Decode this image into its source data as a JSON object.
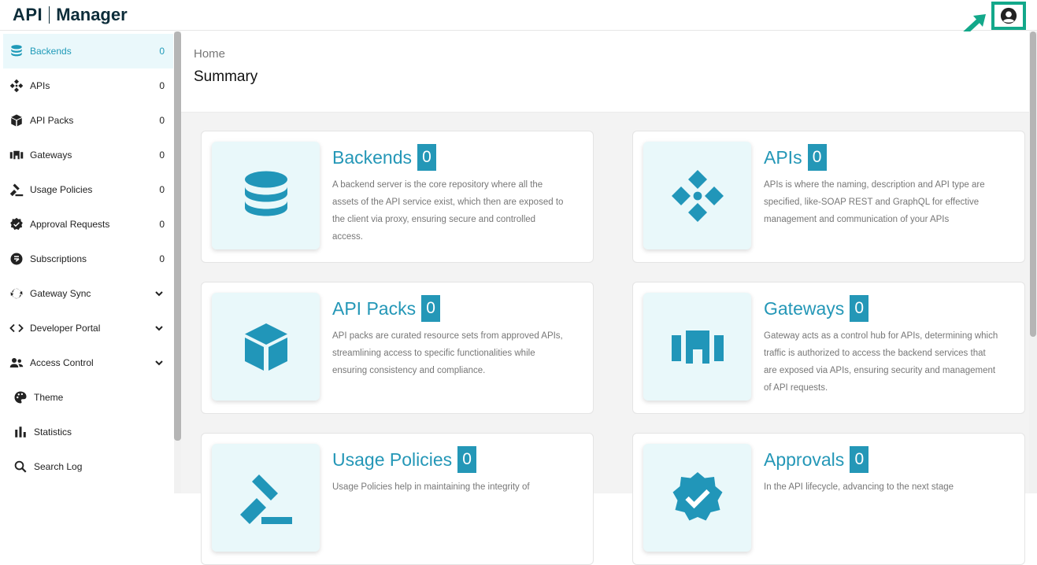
{
  "app": {
    "logo_api": "API",
    "logo_manager": "Manager"
  },
  "header": {
    "breadcrumb": "Home",
    "title": "Summary"
  },
  "sidebar": {
    "items": [
      {
        "label": "Backends",
        "count": "0",
        "icon": "database-icon"
      },
      {
        "label": "APIs",
        "count": "0",
        "icon": "api-diamond-icon"
      },
      {
        "label": "API Packs",
        "count": "0",
        "icon": "box-icon"
      },
      {
        "label": "Gateways",
        "count": "0",
        "icon": "gateway-icon"
      },
      {
        "label": "Usage Policies",
        "count": "0",
        "icon": "gavel-icon"
      },
      {
        "label": "Approval Requests",
        "count": "0",
        "icon": "check-badge-icon"
      },
      {
        "label": "Subscriptions",
        "count": "0",
        "icon": "subscription-icon"
      },
      {
        "label": "Gateway Sync",
        "icon": "sync-icon"
      },
      {
        "label": "Developer Portal",
        "icon": "code-icon"
      },
      {
        "label": "Access Control",
        "icon": "users-icon"
      },
      {
        "label": "Theme",
        "icon": "palette-icon"
      },
      {
        "label": "Statistics",
        "icon": "bar-chart-icon"
      },
      {
        "label": "Search Log",
        "icon": "search-icon"
      }
    ]
  },
  "cards": [
    {
      "title": "Backends",
      "count": "0",
      "icon": "database-icon",
      "desc": "A backend server is the core repository where all the assets of the API service exist, which then are exposed to the client via proxy, ensuring secure and controlled access."
    },
    {
      "title": "APIs",
      "count": "0",
      "icon": "api-diamond-icon",
      "desc": "APIs is where the naming, description and API type are specified, like-SOAP REST and GraphQL for effective management and communication of your APIs"
    },
    {
      "title": "API Packs",
      "count": "0",
      "icon": "box-icon",
      "desc": "API packs are curated resource sets from approved APIs, streamlining access to specific functionalities while ensuring consistency and compliance."
    },
    {
      "title": "Gateways",
      "count": "0",
      "icon": "gateway-icon",
      "desc": "Gateway acts as a control hub for APIs, determining which traffic is authorized to access the backend services that are exposed via APIs, ensuring security and management of API requests."
    },
    {
      "title": "Usage Policies",
      "count": "0",
      "icon": "gavel-icon",
      "desc": "Usage Policies help in maintaining the integrity of"
    },
    {
      "title": "Approvals",
      "count": "0",
      "icon": "check-badge-icon",
      "desc": "In the API lifecycle, advancing to the next stage"
    }
  ],
  "colors": {
    "accent": "#2497b7",
    "highlight": "#13a88a",
    "icon_bg": "#e9f8fa"
  }
}
